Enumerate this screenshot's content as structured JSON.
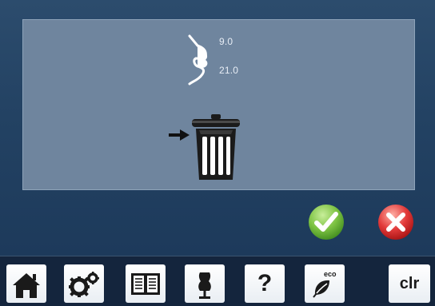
{
  "panel": {
    "value_1": "9.0",
    "value_2": "21.0"
  },
  "actions": {
    "confirm_icon": "checkmark-icon",
    "cancel_icon": "x-icon",
    "confirm_color": "#7cc242",
    "cancel_color": "#e23a3a"
  },
  "toolbar": {
    "home_icon": "home-icon",
    "settings_icon": "gears-icon",
    "book_icon": "open-book-icon",
    "tutorial_icon": "dress-form-icon",
    "help_label": "?",
    "eco_label": "eco",
    "clr_label": "clr"
  }
}
